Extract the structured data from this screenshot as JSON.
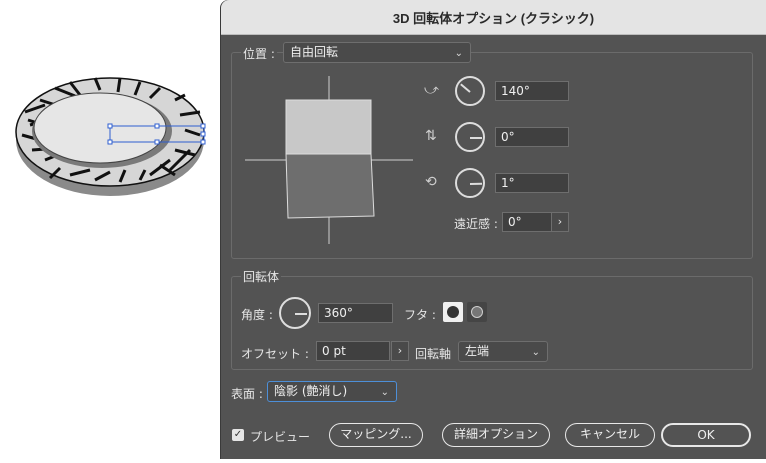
{
  "dialog": {
    "title": "3D 回転体オプション (クラシック)"
  },
  "position": {
    "label": "位置 :",
    "select_value": "自由回転",
    "x_angle": "140°",
    "y_angle": "0°",
    "z_angle": "1°",
    "perspective_label": "遠近感 :",
    "perspective_value": "0°",
    "perspective_arrow": "›"
  },
  "revolve": {
    "section_label": "回転体",
    "angle_label": "角度 :",
    "angle_value": "360°",
    "cap_label": "フタ :",
    "offset_label": "オフセット :",
    "offset_value": "0 pt",
    "offset_arrow": "›",
    "axis_label": "回転軸",
    "axis_value": "左端"
  },
  "surface": {
    "label": "表面 :",
    "value": "陰影 (艶消し)"
  },
  "footer": {
    "preview_label": "プレビュー",
    "preview_checked": true,
    "mapping_button": "マッピング...",
    "more_options_button": "詳細オプション",
    "cancel_button": "キャンセル",
    "ok_button": "OK"
  },
  "icons": {
    "x_axis": "rotate-x-icon",
    "y_axis": "rotate-y-icon",
    "z_axis": "rotate-z-icon",
    "chevron": "chevron-down-icon"
  }
}
